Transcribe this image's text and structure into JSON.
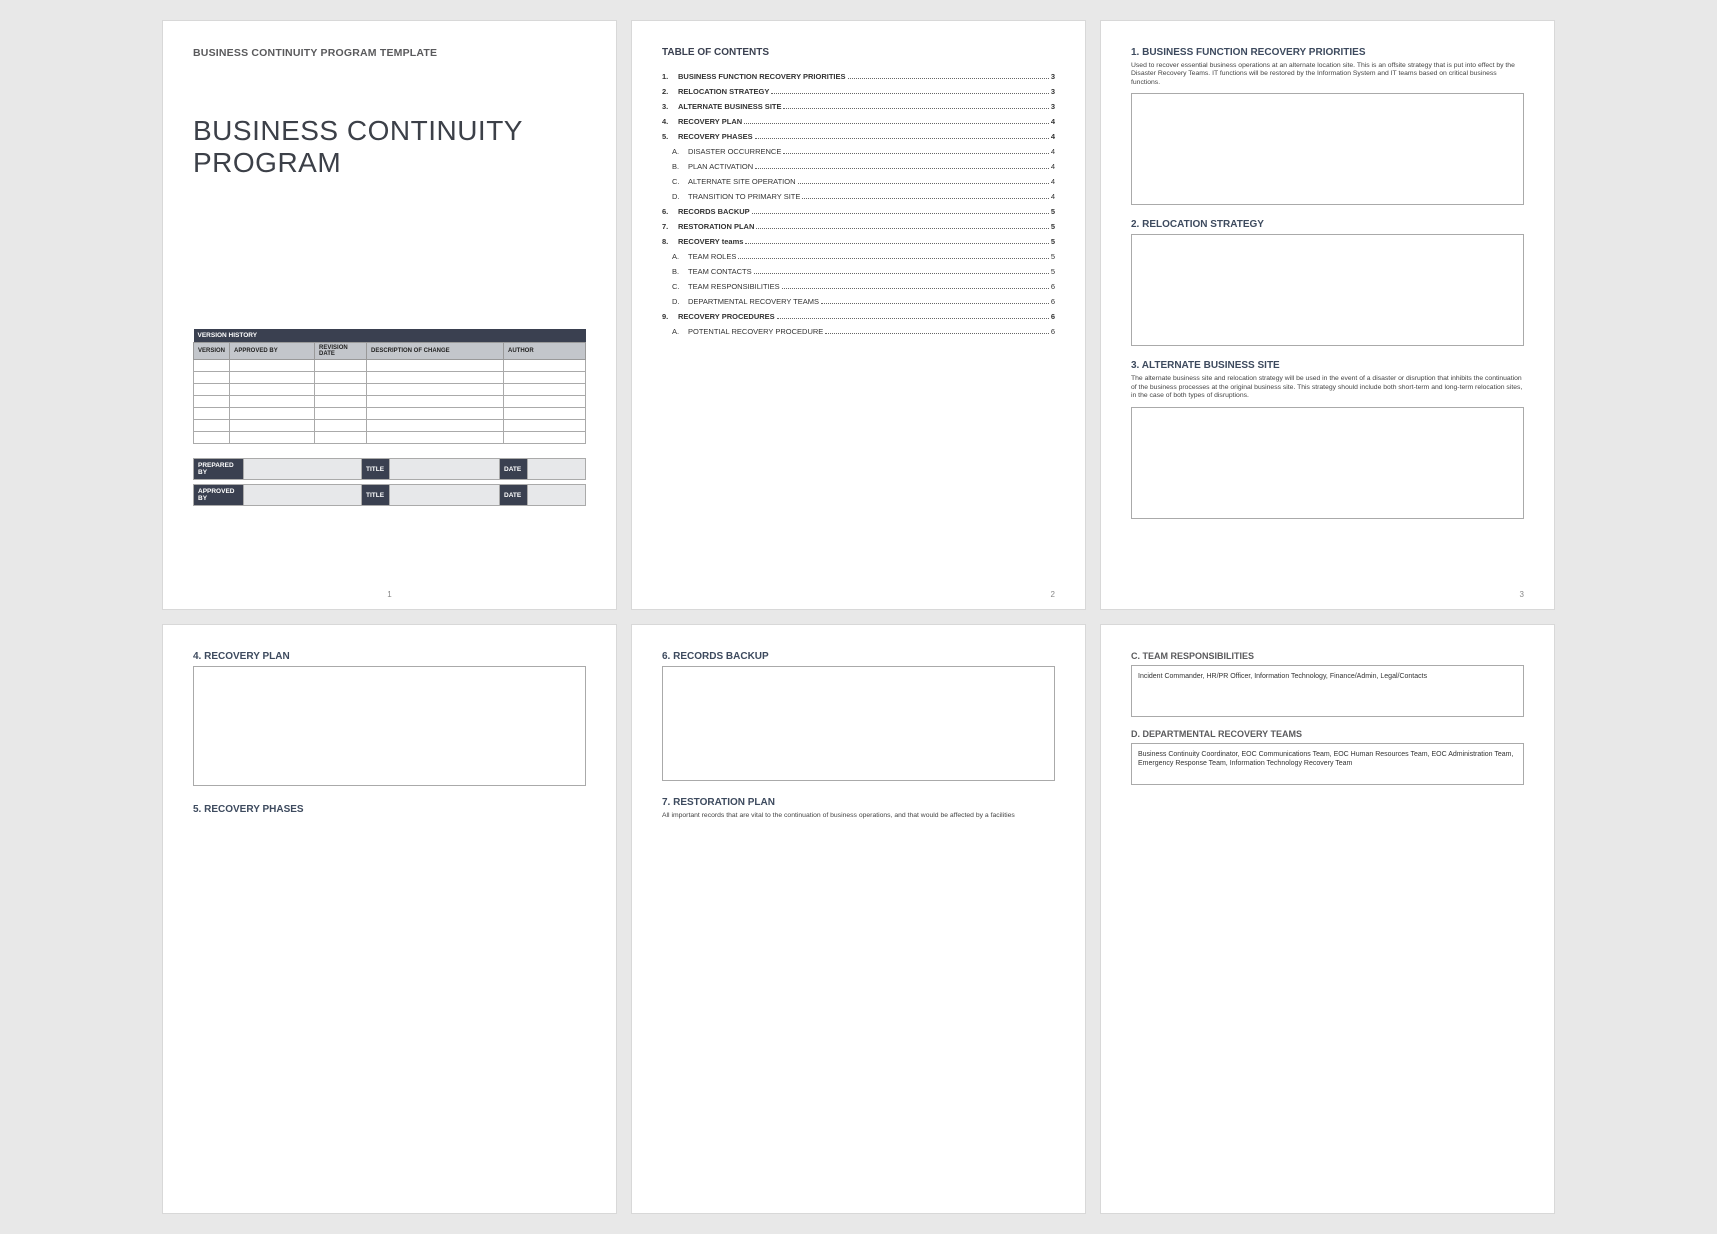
{
  "page1": {
    "template_label": "BUSINESS CONTINUITY PROGRAM TEMPLATE",
    "main_title_line1": "BUSINESS CONTINUITY",
    "main_title_line2": "PROGRAM",
    "version_history_header": "VERSION HISTORY",
    "cols": {
      "version": "VERSION",
      "approved_by": "APPROVED BY",
      "revision_date": "REVISION DATE",
      "description": "DESCRIPTION OF CHANGE",
      "author": "AUTHOR"
    },
    "sign": {
      "prepared_by": "PREPARED BY",
      "approved_by": "APPROVED BY",
      "title": "TITLE",
      "date": "DATE"
    },
    "page_num": "1"
  },
  "page2": {
    "toc_title": "TABLE OF CONTENTS",
    "items": [
      {
        "num": "1.",
        "label": "BUSINESS FUNCTION RECOVERY PRIORITIES",
        "page": "3",
        "bold": true
      },
      {
        "num": "2.",
        "label": "RELOCATION STRATEGY",
        "page": "3",
        "bold": true
      },
      {
        "num": "3.",
        "label": "ALTERNATE BUSINESS SITE",
        "page": "3",
        "bold": true
      },
      {
        "num": "4.",
        "label": "RECOVERY PLAN",
        "page": "4",
        "bold": true
      },
      {
        "num": "5.",
        "label": "RECOVERY PHASES",
        "page": "4",
        "bold": true
      },
      {
        "num": "A.",
        "label": "DISASTER OCCURRENCE",
        "page": "4",
        "sub": true
      },
      {
        "num": "B.",
        "label": "PLAN ACTIVATION",
        "page": "4",
        "sub": true
      },
      {
        "num": "C.",
        "label": "ALTERNATE SITE OPERATION",
        "page": "4",
        "sub": true
      },
      {
        "num": "D.",
        "label": "TRANSITION TO PRIMARY SITE",
        "page": "4",
        "sub": true
      },
      {
        "num": "6.",
        "label": "RECORDS BACKUP",
        "page": "5",
        "bold": true
      },
      {
        "num": "7.",
        "label": "RESTORATION PLAN",
        "page": "5",
        "bold": true
      },
      {
        "num": "8.",
        "label": "RECOVERY teams",
        "page": "5",
        "bold": true
      },
      {
        "num": "A.",
        "label": "TEAM ROLES",
        "page": "5",
        "sub": true
      },
      {
        "num": "B.",
        "label": "TEAM CONTACTS",
        "page": "5",
        "sub": true
      },
      {
        "num": "C.",
        "label": "TEAM RESPONSIBILITIES",
        "page": "6",
        "sub": true
      },
      {
        "num": "D.",
        "label": "DEPARTMENTAL RECOVERY TEAMS",
        "page": "6",
        "sub": true
      },
      {
        "num": "9.",
        "label": "RECOVERY PROCEDURES",
        "page": "6",
        "bold": true
      },
      {
        "num": "A.",
        "label": "POTENTIAL RECOVERY PROCEDURE",
        "page": "6",
        "sub": true
      }
    ],
    "page_num": "2"
  },
  "page3": {
    "s1_heading": "1.  BUSINESS FUNCTION RECOVERY PRIORITIES",
    "s1_desc": "Used to recover essential business operations at an alternate location site. This is an offsite strategy that is put into effect by the Disaster Recovery Teams. IT functions will be restored by the Information System and IT teams based on critical business functions.",
    "s2_heading": "2.  RELOCATION STRATEGY",
    "s3_heading": "3.  ALTERNATE BUSINESS SITE",
    "s3_desc": "The alternate business site and relocation strategy will be used in the event of a disaster or disruption that inhibits the continuation of the business processes at the original business site. This strategy should include both short-term and long-term relocation sites, in the case of both types of disruptions.",
    "page_num": "3"
  },
  "page4": {
    "s4_heading": "4.  RECOVERY PLAN",
    "s5_heading": "5.  RECOVERY PHASES"
  },
  "page5": {
    "s6_heading": "6.  RECORDS BACKUP",
    "s7_heading": "7.  RESTORATION PLAN",
    "s7_desc": "All important records that are vital to the continuation of business operations, and that would be affected by a facilities"
  },
  "page6": {
    "sc_heading": "C.  TEAM RESPONSIBILITIES",
    "sc_content": "Incident Commander, HR/PR Officer, Information Technology, Finance/Admin, Legal/Contacts",
    "sd_heading": "D.  DEPARTMENTAL RECOVERY TEAMS",
    "sd_content": "Business Continuity Coordinator, EOC Communications Team, EOC Human Resources Team, EOC Administration Team, Emergency Response Team, Information Technology Recovery Team"
  }
}
